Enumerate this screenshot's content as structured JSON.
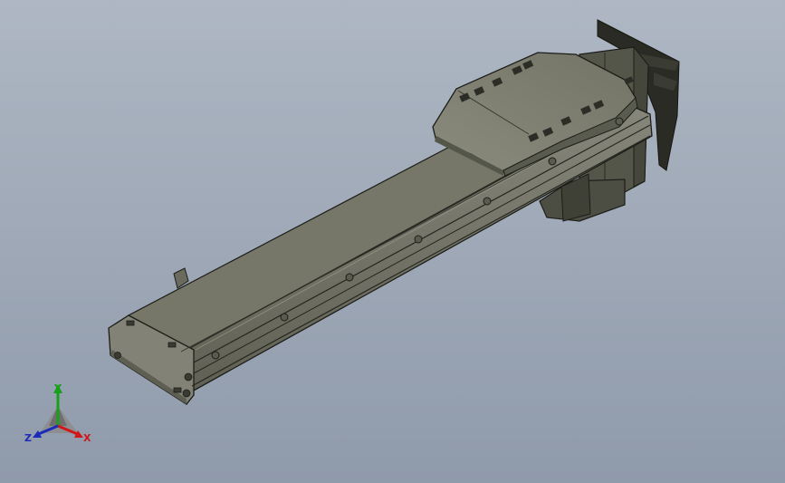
{
  "viewport": {
    "background_top": "#aeb7c3",
    "background_bottom": "#8f9aab"
  },
  "model": {
    "description_icon": "linear-actuator-3d-model",
    "body_color": "#6f7062",
    "edge_color": "#1c1d18"
  },
  "triad": {
    "x_label": "X",
    "y_label": "Y",
    "z_label": "Z",
    "x_color": "#d01818",
    "y_color": "#18a018",
    "z_color": "#1b2bb8"
  }
}
